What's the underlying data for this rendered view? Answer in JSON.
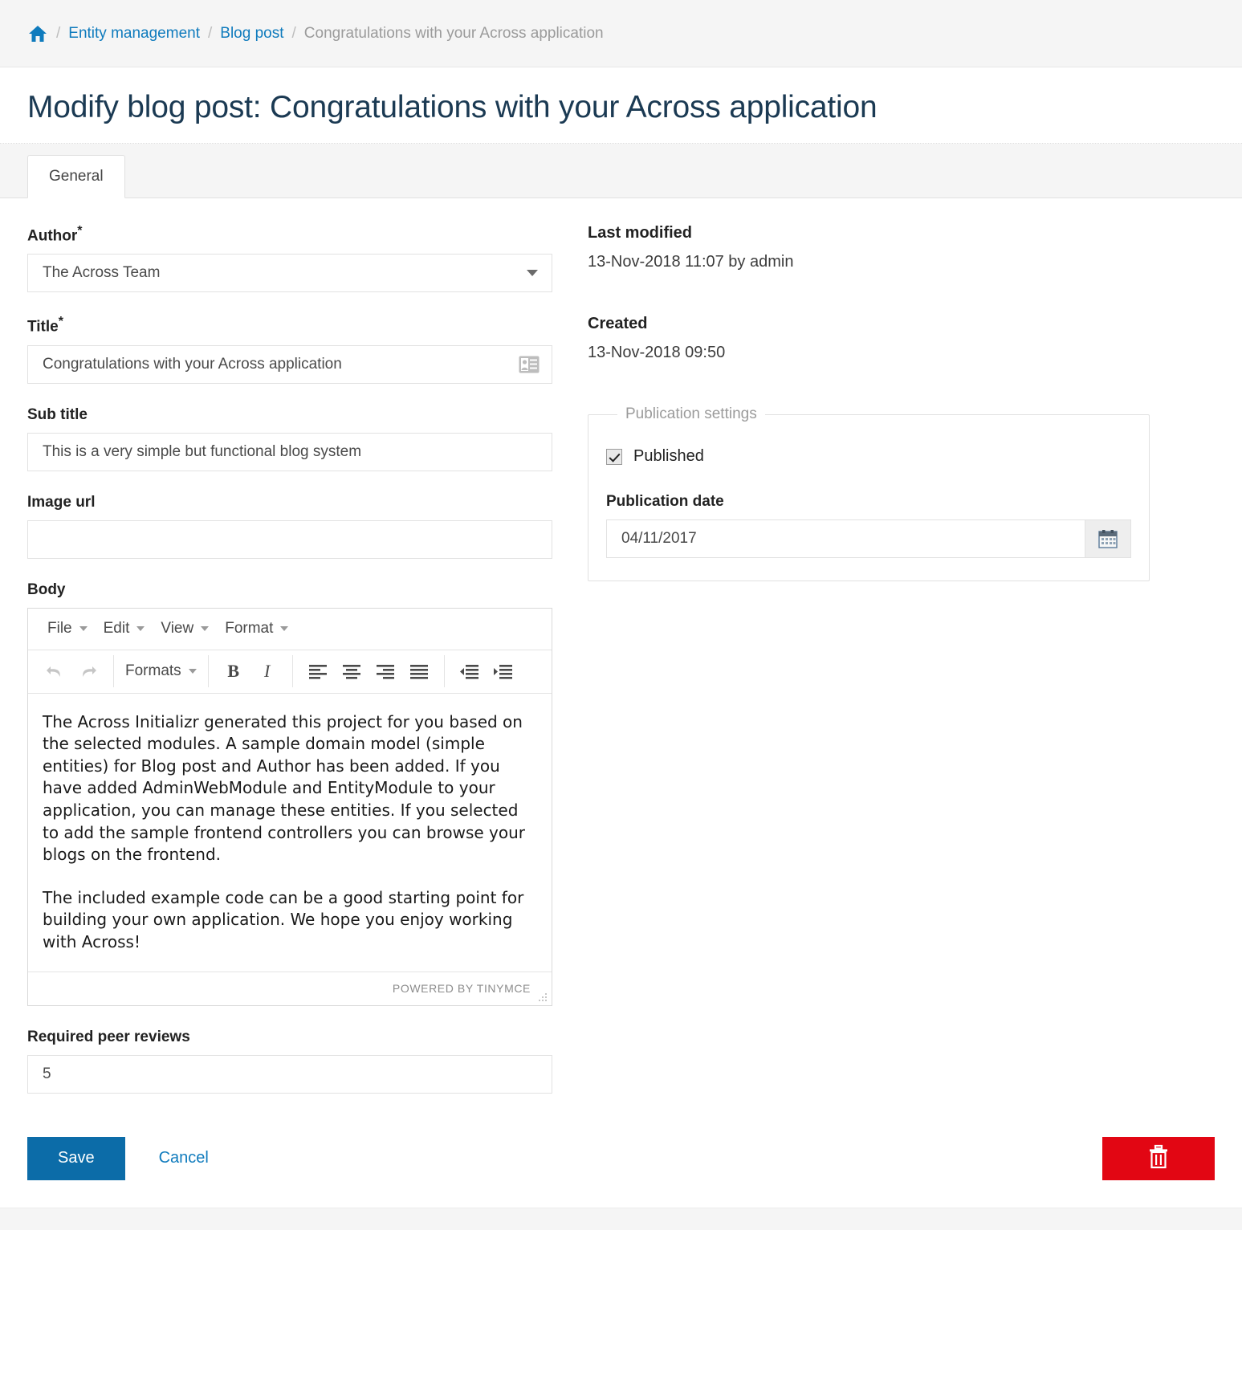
{
  "breadcrumb": {
    "home_icon": "home-icon",
    "separator": "/",
    "items": [
      {
        "label": "Entity management",
        "link": true
      },
      {
        "label": "Blog post",
        "link": true
      },
      {
        "label": "Congratulations with your Across application",
        "link": false
      }
    ]
  },
  "page": {
    "title": "Modify blog post: Congratulations with your Across application"
  },
  "tabs": [
    {
      "label": "General",
      "active": true
    }
  ],
  "form": {
    "author": {
      "label": "Author",
      "required_marker": "*",
      "value": "The Across Team",
      "icon": "chevron-down-icon"
    },
    "title": {
      "label": "Title",
      "required_marker": "*",
      "value": "Congratulations with your Across application",
      "icon": "vcard-icon"
    },
    "sub_title": {
      "label": "Sub title",
      "value": "This is a very simple but functional blog system"
    },
    "image_url": {
      "label": "Image url",
      "value": ""
    },
    "body": {
      "label": "Body"
    },
    "required_peer_reviews": {
      "label": "Required peer reviews",
      "value": "5"
    }
  },
  "meta": {
    "last_modified": {
      "label": "Last modified",
      "value": "13-Nov-2018 11:07 by admin"
    },
    "created": {
      "label": "Created",
      "value": "13-Nov-2018 09:50"
    }
  },
  "publication": {
    "legend": "Publication settings",
    "published": {
      "label": "Published",
      "checked": true
    },
    "publication_date": {
      "label": "Publication date",
      "value": "04/11/2017",
      "button_icon": "calendar-icon"
    }
  },
  "editor": {
    "menu": [
      {
        "label": "File"
      },
      {
        "label": "Edit"
      },
      {
        "label": "View"
      },
      {
        "label": "Format"
      }
    ],
    "toolbar": {
      "undo": "undo-icon",
      "redo": "redo-icon",
      "formats_label": "Formats",
      "bold": "B",
      "italic": "I",
      "align_left": "align-left-icon",
      "align_center": "align-center-icon",
      "align_right": "align-right-icon",
      "align_justify": "align-justify-icon",
      "outdent": "outdent-icon",
      "indent": "indent-icon"
    },
    "content": [
      "The Across Initializr generated this project for you based on the selected modules. A sample domain model (simple entities) for Blog post and Author has been added. If you have added AdminWebModule and EntityModule to your application, you can manage these entities. If you selected to add the sample frontend controllers you can browse your blogs on the frontend.",
      "The included example code can be a good starting point for building your own application. We hope you enjoy working with Across!"
    ],
    "status": "POWERED BY TINYMCE"
  },
  "footer": {
    "save_label": "Save",
    "cancel_label": "Cancel",
    "delete_icon": "trash-icon"
  },
  "colors": {
    "accent": "#0f7bbd",
    "save_button": "#0c6ca8",
    "delete_button": "#e20613",
    "title_text": "#1b3a53",
    "muted_text": "#9b9b9b"
  }
}
